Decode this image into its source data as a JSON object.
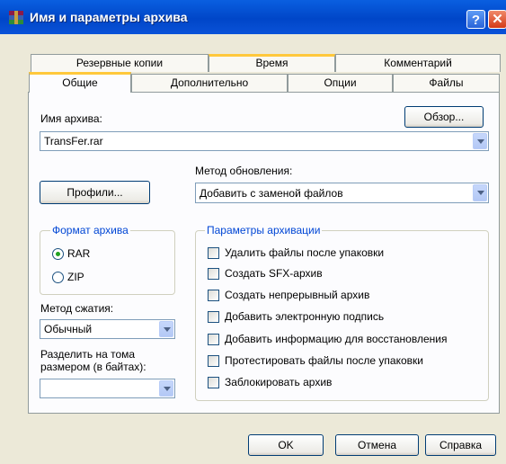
{
  "window": {
    "title": "Имя и параметры архива",
    "help_label": "?",
    "close_label": "✕"
  },
  "tabs_row1": [
    "Резервные копии",
    "Время",
    "Комментарий"
  ],
  "tabs_row2": [
    "Общие",
    "Дополнительно",
    "Опции",
    "Файлы"
  ],
  "archive_name": {
    "label": "Имя архива:",
    "value": "TransFer.rar",
    "browse_label": "Обзор..."
  },
  "update_method": {
    "label": "Метод обновления:",
    "value": "Добавить с заменой файлов"
  },
  "profiles_label": "Профили...",
  "archive_format": {
    "title": "Формат архива",
    "options": [
      "RAR",
      "ZIP"
    ],
    "selected": "RAR"
  },
  "compression": {
    "label": "Метод сжатия:",
    "value": "Обычный"
  },
  "split": {
    "label_line1": "Разделить на тома",
    "label_line2": "размером (в байтах):",
    "value": ""
  },
  "archiving_params": {
    "title": "Параметры архивации",
    "options": [
      "Удалить файлы после упаковки",
      "Создать SFX-архив",
      "Создать непрерывный архив",
      "Добавить электронную подпись",
      "Добавить информацию для восстановления",
      "Протестировать файлы после упаковки",
      "Заблокировать архив"
    ]
  },
  "footer": {
    "ok_label": "OK",
    "cancel_label": "Отмена",
    "help_label": "Справка"
  },
  "colors": {
    "title_bar": "#0a52d8",
    "dialog_bg": "#ece9d8",
    "group_title": "#0046d5",
    "tab_highlight": "#ffc83c"
  },
  "icons": {
    "app": "winrar-icon"
  }
}
